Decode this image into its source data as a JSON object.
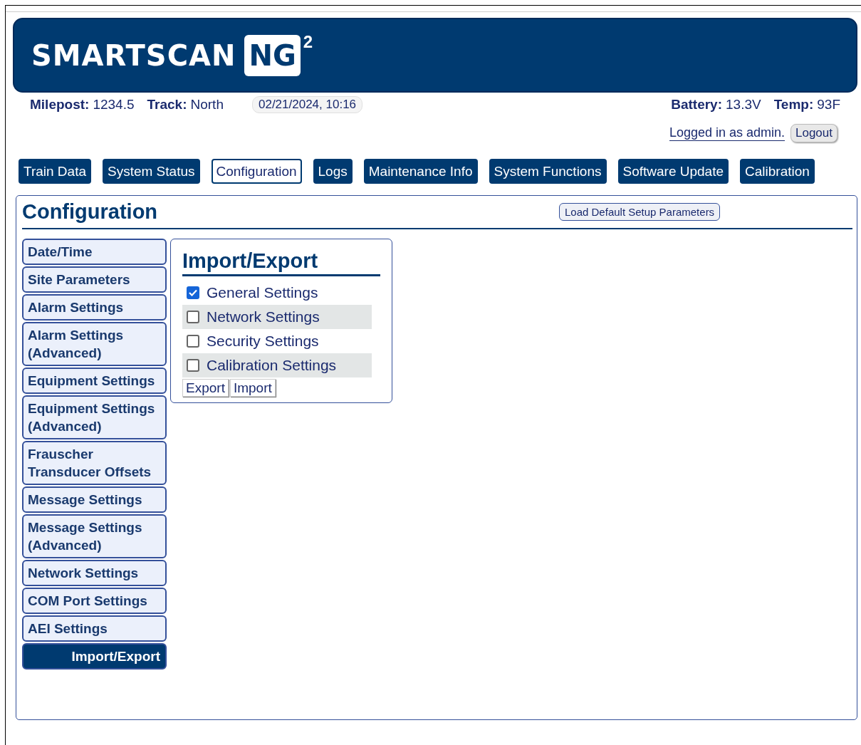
{
  "logo": {
    "brand": "SMARTSCAN",
    "badge": "NG",
    "superscript": "2"
  },
  "info": {
    "milepost_label": "Milepost:",
    "milepost": "1234.5",
    "track_label": "Track:",
    "track": "North",
    "datetime": "02/21/2024, 10:16",
    "battery_label": "Battery:",
    "battery": "13.3V",
    "temp_label": "Temp:",
    "temp": "93F"
  },
  "session": {
    "logged_in": "Logged in as admin.",
    "logout": "Logout"
  },
  "tabs": [
    {
      "label": "Train Data",
      "selected": false
    },
    {
      "label": "System Status",
      "selected": false
    },
    {
      "label": "Configuration",
      "selected": true
    },
    {
      "label": "Logs",
      "selected": false
    },
    {
      "label": "Maintenance Info",
      "selected": false
    },
    {
      "label": "System Functions",
      "selected": false
    },
    {
      "label": "Software Update",
      "selected": false
    },
    {
      "label": "Calibration",
      "selected": false
    }
  ],
  "page": {
    "title": "Configuration",
    "load_defaults": "Load Default Setup Parameters"
  },
  "sidebar": {
    "items": [
      {
        "label": "Date/Time",
        "selected": false
      },
      {
        "label": "Site Parameters",
        "selected": false
      },
      {
        "label": "Alarm Settings",
        "selected": false
      },
      {
        "label": "Alarm Settings (Advanced)",
        "selected": false
      },
      {
        "label": "Equipment Settings",
        "selected": false
      },
      {
        "label": "Equipment Settings (Advanced)",
        "selected": false
      },
      {
        "label": "Frauscher Transducer Offsets",
        "selected": false
      },
      {
        "label": "Message Settings",
        "selected": false
      },
      {
        "label": "Message Settings (Advanced)",
        "selected": false
      },
      {
        "label": "Network Settings",
        "selected": false
      },
      {
        "label": "COM Port Settings",
        "selected": false
      },
      {
        "label": "AEI Settings",
        "selected": false
      },
      {
        "label": "Import/Export",
        "selected": true
      }
    ]
  },
  "import_export": {
    "title": "Import/Export",
    "options": [
      {
        "label": "General Settings",
        "checked": true
      },
      {
        "label": "Network Settings",
        "checked": false
      },
      {
        "label": "Security Settings",
        "checked": false
      },
      {
        "label": "Calibration Settings",
        "checked": false
      }
    ],
    "buttons": [
      "Export",
      "Import"
    ]
  }
}
